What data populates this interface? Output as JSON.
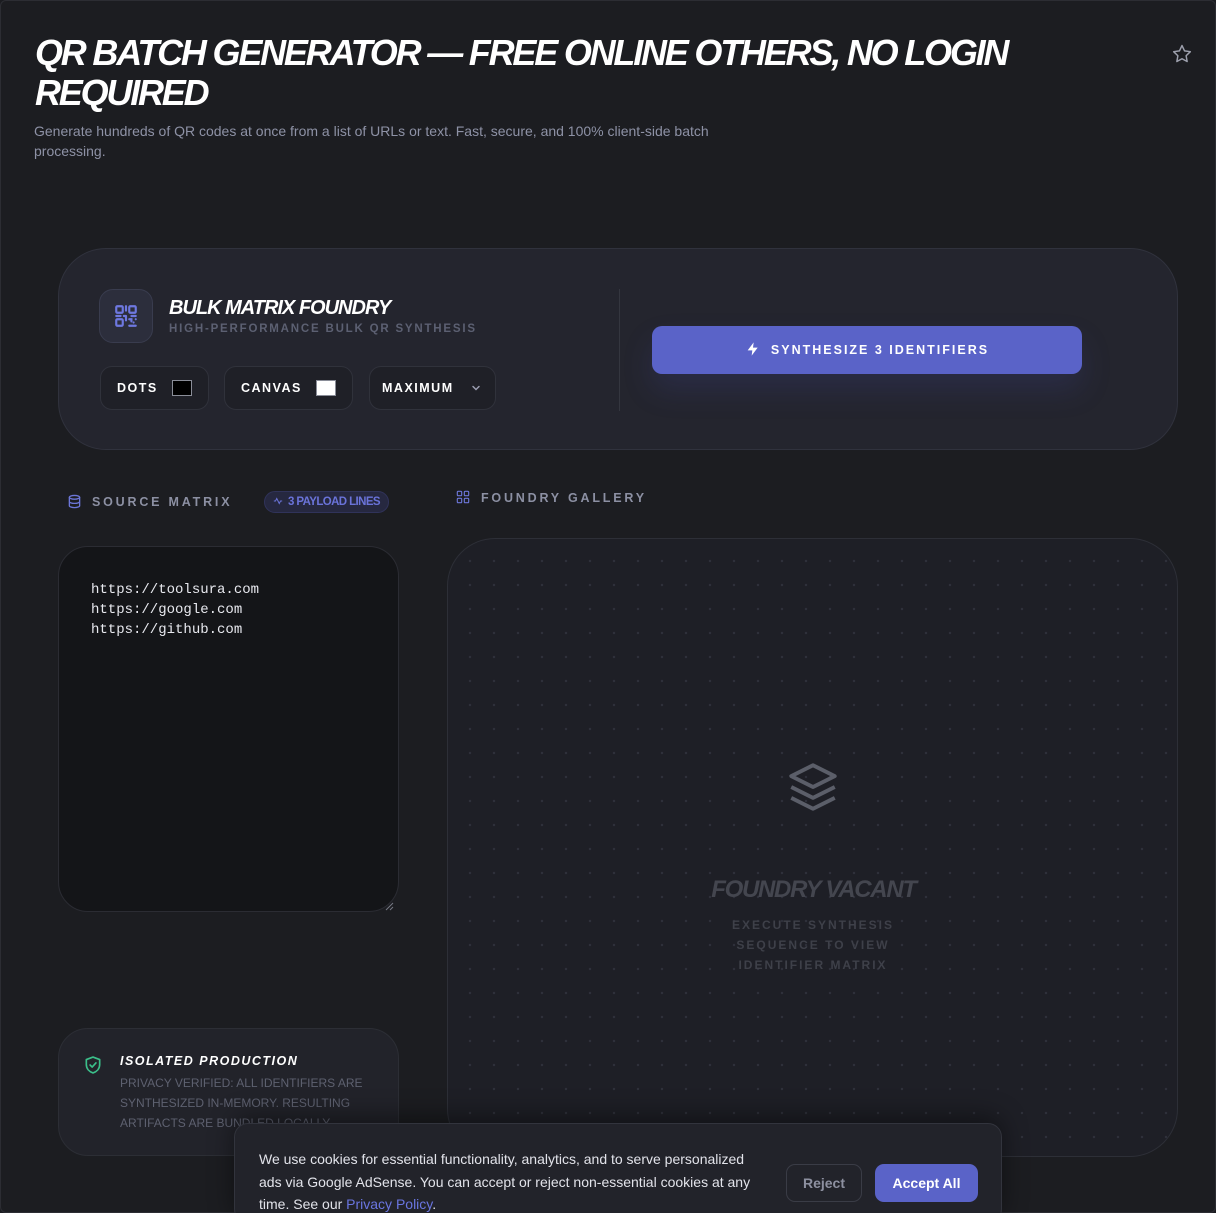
{
  "header": {
    "title": "QR BATCH GENERATOR — FREE ONLINE OTHERS, NO LOGIN REQUIRED",
    "subtitle": "Generate hundreds of QR codes at once from a list of URLs or text. Fast, secure, and 100% client-side batch processing.",
    "favorite_icon": "star-icon"
  },
  "foundry": {
    "title": "BULK MATRIX FOUNDRY",
    "subtitle": "HIGH-PERFORMANCE BULK QR SYNTHESIS",
    "logo_icon": "qr-code-icon",
    "dots_label": "DOTS",
    "dots_color": "#000000",
    "canvas_label": "CANVAS",
    "canvas_color": "#ffffff",
    "quality_selected": "MAXIMUM",
    "synthesize_label": "SYNTHESIZE 3 IDENTIFIERS"
  },
  "source": {
    "label": "SOURCE MATRIX",
    "badge": "3 PAYLOAD LINES",
    "lines": [
      "https://toolsura.com",
      "https://google.com",
      "https://github.com"
    ]
  },
  "gallery": {
    "label": "FOUNDRY GALLERY",
    "empty_title": "FOUNDRY VACANT",
    "empty_subtitle": "EXECUTE SYNTHESIS SEQUENCE TO VIEW IDENTIFIER MATRIX"
  },
  "isolated": {
    "title": "ISOLATED PRODUCTION",
    "text": "PRIVACY VERIFIED: ALL IDENTIFIERS ARE SYNTHESIZED IN-MEMORY. RESULTING ARTIFACTS ARE BUNDLED LOCALLY."
  },
  "cookie": {
    "text": "We use cookies for essential functionality, analytics, and to serve personalized ads via Google AdSense. You can accept or reject non-essential cookies at any time. See our ",
    "link": "Privacy Policy",
    "end": ".",
    "reject": "Reject",
    "accept": "Accept All"
  },
  "colors": {
    "accent": "#5a63c8",
    "background": "#1c1d21",
    "success": "#3bbf8a"
  }
}
